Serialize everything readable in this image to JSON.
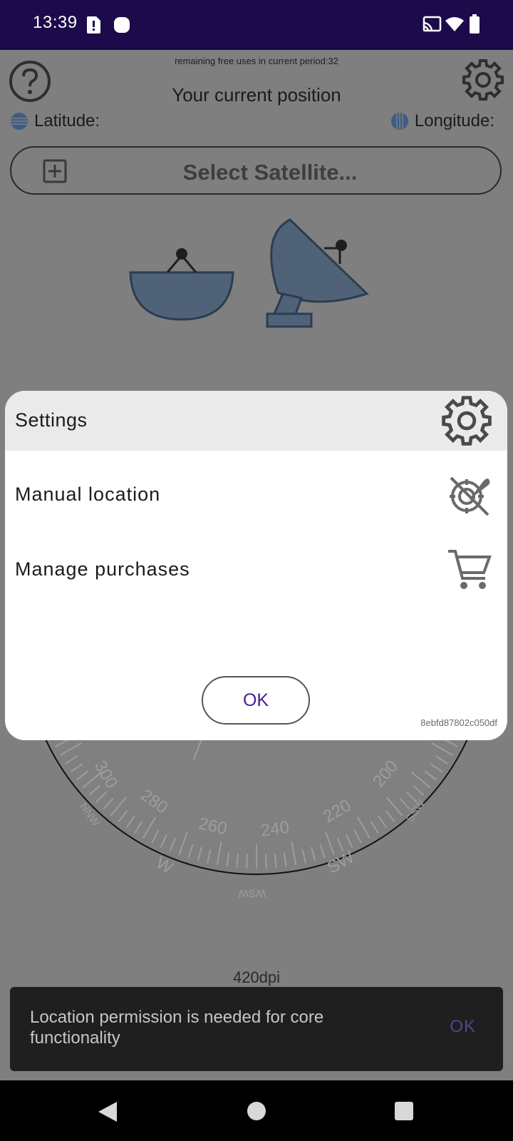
{
  "status_bar": {
    "time": "13:39",
    "icons": [
      "alert-sim-icon",
      "circle-notification-icon",
      "cast-icon",
      "wifi-icon",
      "battery-icon"
    ]
  },
  "app": {
    "free_uses": "remaining free uses in current period:32",
    "current_position": "Your current position",
    "latitude_label": "Latitude:",
    "longitude_label": "Longitude:",
    "select_satellite": "Select Satellite...",
    "dpi": "420dpi",
    "compass_labels": [
      "300",
      "NNW",
      "280",
      "260",
      "240",
      "220",
      "200",
      "SSW",
      "SW",
      "WSW",
      "W"
    ]
  },
  "dialog": {
    "title": "Settings",
    "items": [
      {
        "label": "Manual location",
        "icon": "manual-location-icon"
      },
      {
        "label": "Manage purchases",
        "icon": "cart-icon"
      }
    ],
    "ok_label": "OK",
    "device_id": "8ebfd87802c050df"
  },
  "snackbar": {
    "message": "Location permission is needed for core functionality",
    "action": "OK"
  },
  "colors": {
    "status_bar": "#1c0a4a",
    "accent": "#4a1c91",
    "dish": "#4f6277"
  }
}
